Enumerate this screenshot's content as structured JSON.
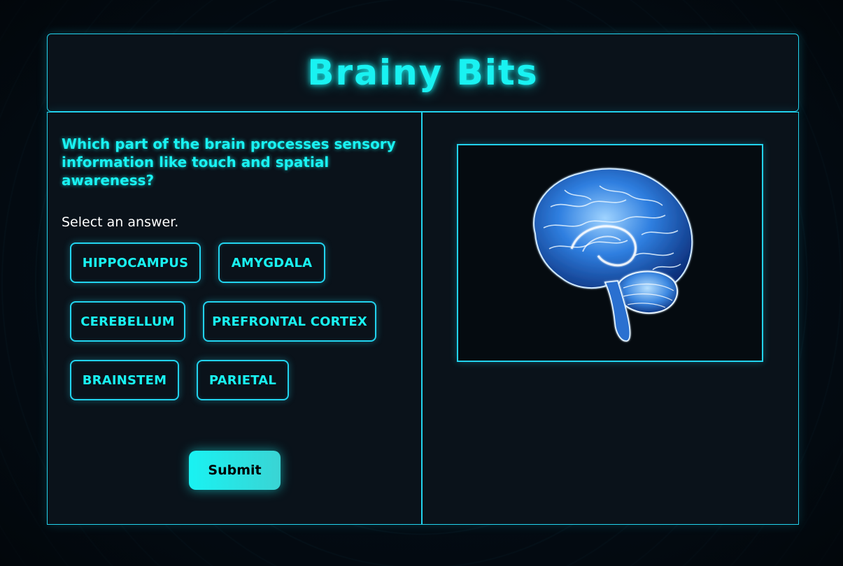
{
  "header": {
    "title": "Brainy Bits"
  },
  "quiz": {
    "question": "Which part of the brain processes sensory information like touch and spatial awareness?",
    "prompt": "Select an answer.",
    "answers": [
      "HIPPOCAMPUS",
      "AMYGDALA",
      "CEREBELLUM",
      "PREFRONTAL CORTEX",
      "BRAINSTEM",
      "PARIETAL"
    ],
    "submit_label": "Submit"
  },
  "illustration": {
    "icon": "brain-illustration"
  },
  "colors": {
    "accent": "#19f2f2",
    "border": "#22d3ee",
    "panel_bg": "#0a121a",
    "page_bg": "#030b12",
    "brain_blue": "#1e63c6"
  }
}
